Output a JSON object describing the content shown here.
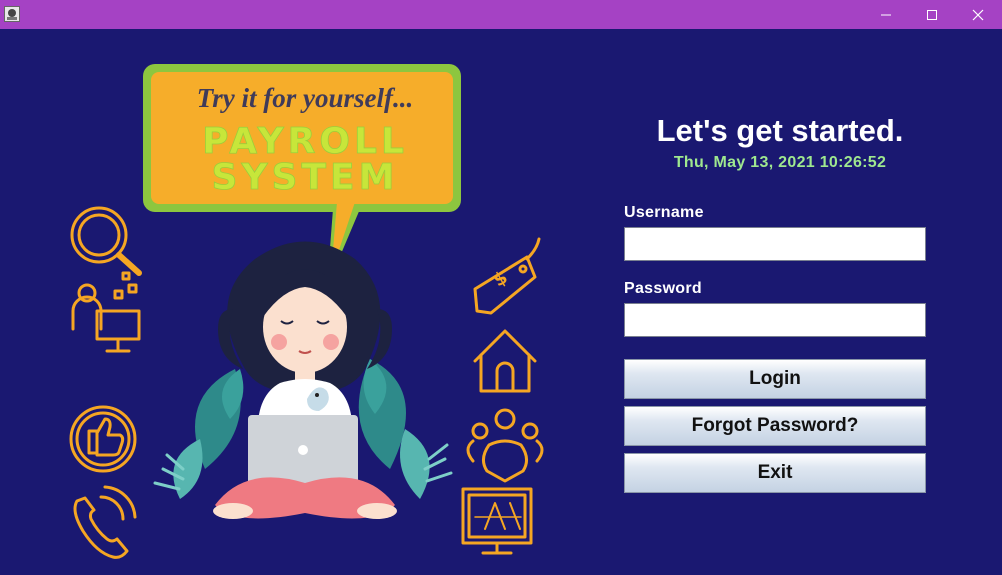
{
  "window": {
    "icon": "app-logo-icon",
    "controls": [
      "minimize-icon",
      "maximize-icon",
      "close-icon"
    ],
    "titlebar_color": "#a542c4"
  },
  "illustration": {
    "tagline": "Try it for yourself...",
    "title_line1": "PAYROLL",
    "title_line2": "SYSTEM",
    "icons_left": [
      "magnifier-icon",
      "team-workstation-icon",
      "thumbs-up-icon",
      "phone-icon"
    ],
    "icons_right": [
      "price-tag-icon",
      "house-icon",
      "group-icon",
      "blueprint-monitor-icon"
    ],
    "bubble_color": "#f6ad2a",
    "bubble_border_color": "#8dc63f",
    "icon_color": "#f5a623"
  },
  "login": {
    "heading": "Let's get started.",
    "datetime": "Thu, May 13, 2021 10:26:52",
    "username_label": "Username",
    "username_value": "",
    "password_label": "Password",
    "password_value": "",
    "login_button": "Login",
    "forgot_button": "Forgot Password?",
    "exit_button": "Exit"
  },
  "colors": {
    "background": "#1a1871",
    "datetime": "#9fe88f",
    "heading": "#ffffff"
  }
}
